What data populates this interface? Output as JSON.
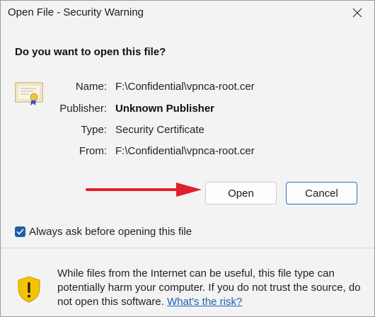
{
  "window": {
    "title": "Open File - Security Warning"
  },
  "question": "Do you want to open this file?",
  "fields": {
    "name_label": "Name:",
    "name_value": "F:\\Confidential\\vpnca-root.cer",
    "publisher_label": "Publisher:",
    "publisher_value": "Unknown Publisher",
    "type_label": "Type:",
    "type_value": "Security Certificate",
    "from_label": "From:",
    "from_value": "F:\\Confidential\\vpnca-root.cer"
  },
  "buttons": {
    "open": "Open",
    "cancel": "Cancel"
  },
  "checkbox": {
    "label": "Always ask before opening this file",
    "checked": true
  },
  "warning": {
    "text": "While files from the Internet can be useful, this file type can potentially harm your computer. If you do not trust the source, do not open this software.",
    "link": "What's the risk?"
  },
  "icons": {
    "certificate": "certificate-icon",
    "shield": "shield-warning-icon",
    "close": "close-icon",
    "arrow": "red-arrow"
  },
  "colors": {
    "accent": "#1f5faa",
    "link": "#1a62b8",
    "arrow": "#e0202a",
    "shield": "#f5c400"
  }
}
